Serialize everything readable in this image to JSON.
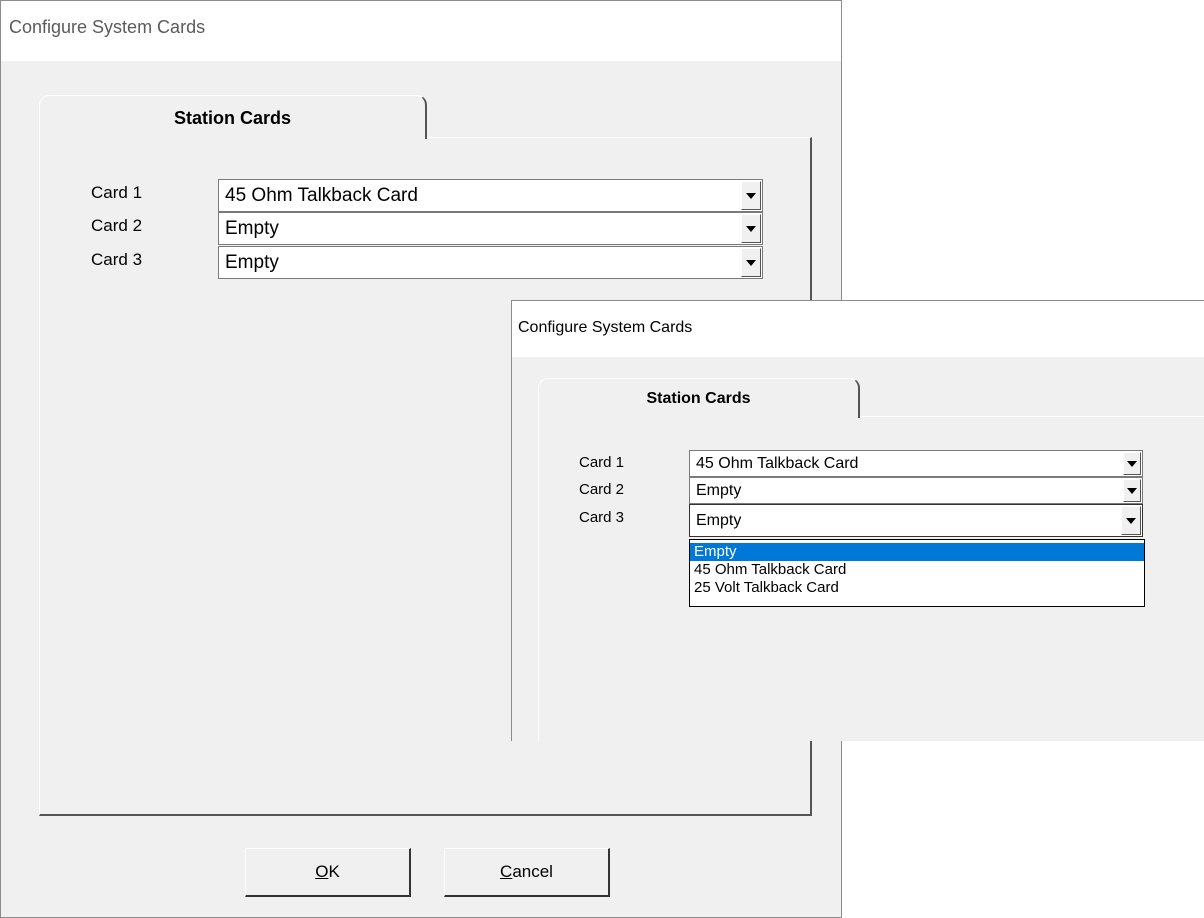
{
  "window_title": "Configure System Cards",
  "tab_label": "Station Cards",
  "cards": [
    {
      "label": "Card 1",
      "value": "45 Ohm Talkback Card"
    },
    {
      "label": "Card 2",
      "value": "Empty"
    },
    {
      "label": "Card 3",
      "value": "Empty"
    }
  ],
  "buttons": {
    "ok_mnemonic": "O",
    "ok_rest": "K",
    "cancel_mnemonic": "C",
    "cancel_rest": "ancel"
  },
  "dropdown_options": [
    {
      "label": "Empty",
      "selected": true
    },
    {
      "label": "45 Ohm Talkback Card",
      "selected": false
    },
    {
      "label": "25 Volt Talkback Card",
      "selected": false
    }
  ],
  "colors": {
    "selection": "#0078d7",
    "dialog_bg": "#f0f0f0",
    "title_text": "#5b5b5b"
  }
}
